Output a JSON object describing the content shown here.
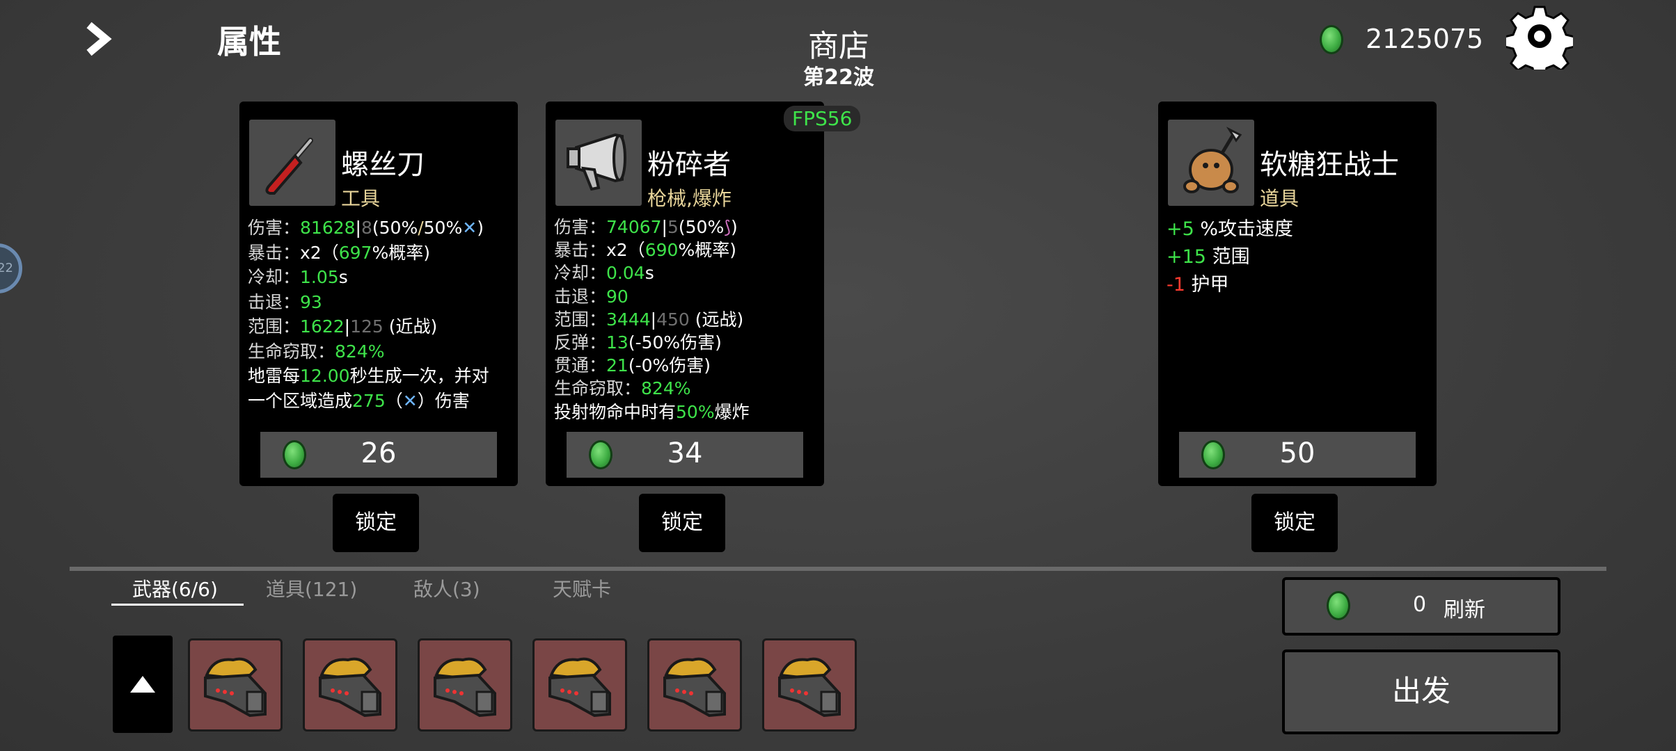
{
  "header": {
    "back_label": "属性",
    "title": "商店",
    "wave": "第22波",
    "currency": "2125075",
    "fps": "FPS56"
  },
  "colors": {
    "stat_green": "#3ee34a",
    "negative_red": "#ff3b30",
    "type_tan": "#e8d59a",
    "slot_bg": "#7a4646"
  },
  "cards": [
    {
      "name": "螺丝刀",
      "type": "工具",
      "price": "26",
      "lock_label": "锁定",
      "icon": "screwdriver-icon",
      "stats": {
        "damage_label": "伤害：",
        "damage_value": "81628",
        "damage_base": "8",
        "damage_scale": "(50%",
        "damage_scale2": "50%",
        "damage_end": ")",
        "crit_label": "暴击：",
        "crit_mult": "x2（",
        "crit_chance": "697",
        "crit_end": "%概率)",
        "cooldown_label": "冷却：",
        "cooldown_value": "1.05",
        "cooldown_unit": "s",
        "knockback_label": "击退：",
        "knockback_value": "93",
        "range_label": "范围：",
        "range_value": "1622",
        "range_base": "125",
        "range_type": "(近战)",
        "lifesteal_label": "生命窃取：",
        "lifesteal_value": "824%",
        "effect_1a": "地雷每",
        "effect_1b": "12.00",
        "effect_1c": "秒生成一次，并对",
        "effect_2a": "一个区域造成",
        "effect_2b": "275",
        "effect_2c": "（",
        "effect_2d": "）伤害"
      }
    },
    {
      "name": "粉碎者",
      "type": "枪械,爆炸",
      "price": "34",
      "lock_label": "锁定",
      "icon": "megaphone-gun-icon",
      "stats": {
        "damage_label": "伤害：",
        "damage_value": "74067",
        "damage_base": "5",
        "damage_scale": "(50%",
        "damage_end": ")",
        "crit_label": "暴击：",
        "crit_mult": "x2（",
        "crit_chance": "690",
        "crit_end": "%概率)",
        "cooldown_label": "冷却：",
        "cooldown_value": "0.04",
        "cooldown_unit": "s",
        "knockback_label": "击退：",
        "knockback_value": "90",
        "range_label": "范围：",
        "range_value": "3444",
        "range_base": "450",
        "range_type": "(远战)",
        "bounce_label": "反弹：",
        "bounce_value": "13",
        "bounce_note": "(-50%伤害)",
        "pierce_label": "贯通：",
        "pierce_value": "21",
        "pierce_note": "(-0%伤害)",
        "lifesteal_label": "生命窃取：",
        "lifesteal_value": "824%",
        "effect_1a": "投射物命中时有",
        "effect_1b": "50%",
        "effect_1c": "爆炸"
      }
    },
    {
      "name": "软糖狂战士",
      "type": "道具",
      "price": "50",
      "lock_label": "锁定",
      "icon": "gummy-berserker-icon",
      "stats": {
        "s1_value": "+5",
        "s1_label": " %攻击速度",
        "s2_value": "+15",
        "s2_label": " 范围",
        "s3_value": "-1",
        "s3_label": " 护甲"
      }
    }
  ],
  "tabs": [
    {
      "label": "武器(6/6)",
      "active": true
    },
    {
      "label": "道具(121)",
      "active": false
    },
    {
      "label": "敌人(3)",
      "active": false
    },
    {
      "label": "天赋卡",
      "active": false
    }
  ],
  "refresh": {
    "cost": "0",
    "label": "刷新"
  },
  "go_label": "出发",
  "side_badge": "22",
  "inventory": [
    "weapon-slot-1",
    "weapon-slot-2",
    "weapon-slot-3",
    "weapon-slot-4",
    "weapon-slot-5",
    "weapon-slot-6"
  ]
}
